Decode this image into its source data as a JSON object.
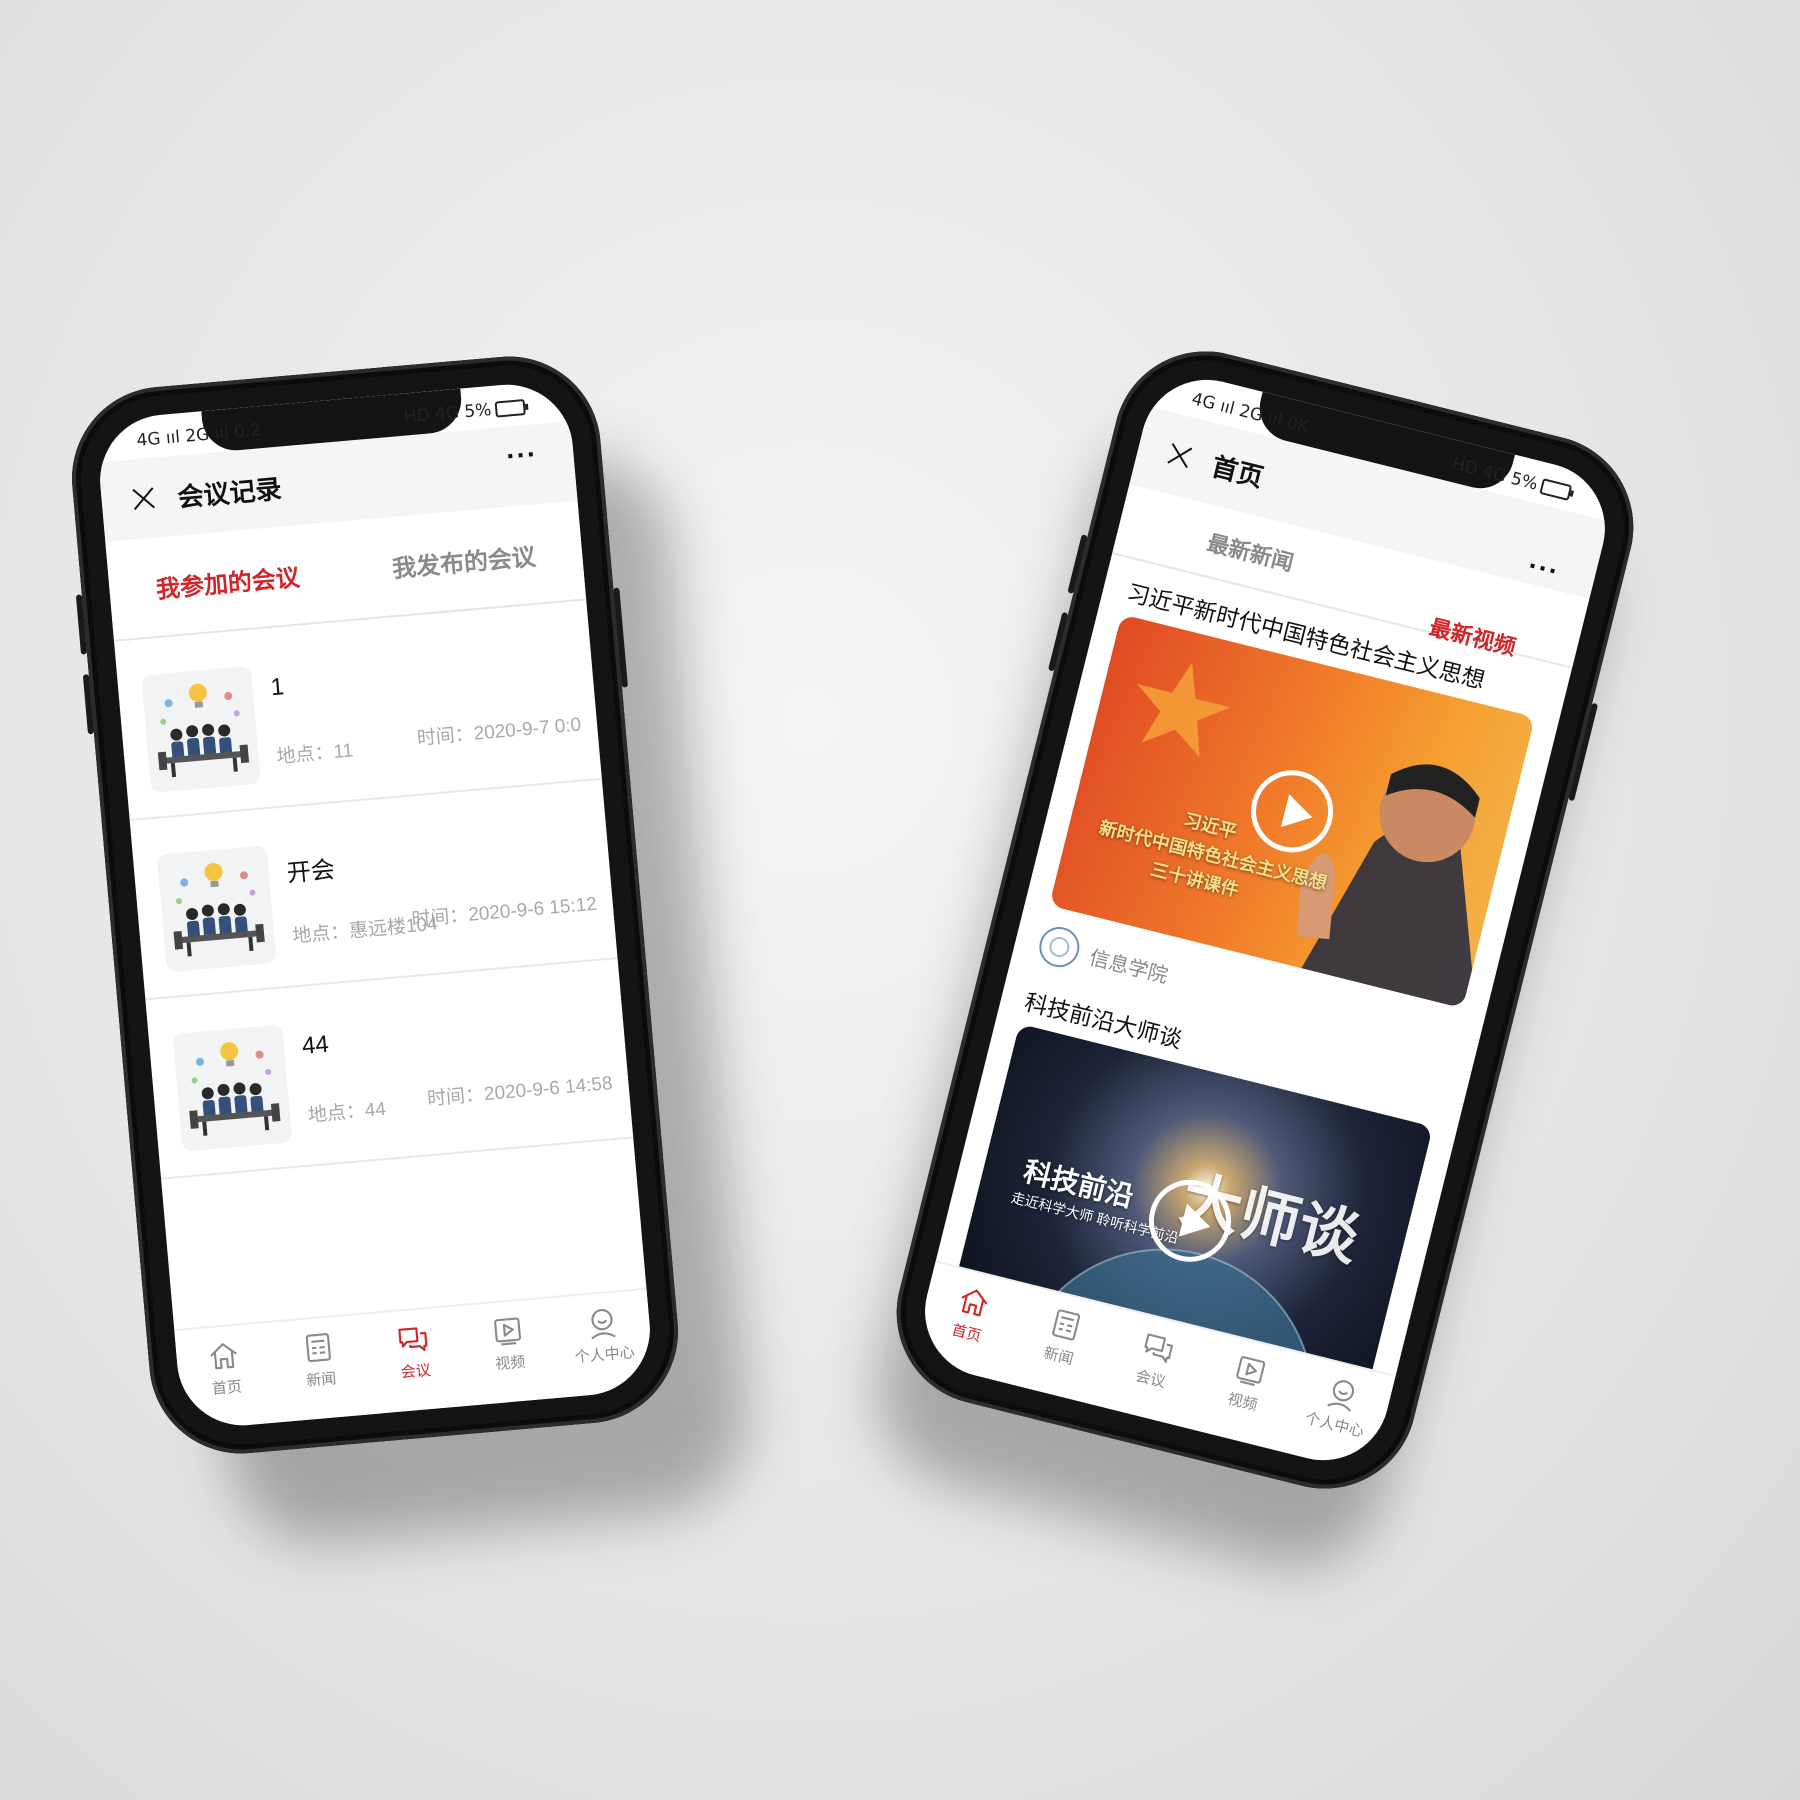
{
  "left_phone": {
    "status_left": "4G ııl 2G ııl 0.2",
    "status_right": "HD 4G 5%",
    "nav": {
      "title": "会议记录",
      "more": "···"
    },
    "tabs": [
      {
        "label": "我参加的会议",
        "active": true
      },
      {
        "label": "我发布的会议",
        "active": false
      }
    ],
    "meetings": [
      {
        "title": "1",
        "location": "地点：11",
        "time": "时间：2020-9-7 0:0"
      },
      {
        "title": "开会",
        "location": "地点：惠远楼104",
        "time": "时间：2020-9-6 15:12"
      },
      {
        "title": "44",
        "location": "地点：44",
        "time": "时间：2020-9-6 14:58"
      }
    ],
    "tabbar": [
      {
        "label": "首页",
        "icon": "home-icon",
        "active": false
      },
      {
        "label": "新闻",
        "icon": "news-icon",
        "active": false
      },
      {
        "label": "会议",
        "icon": "meeting-icon",
        "active": true
      },
      {
        "label": "视频",
        "icon": "video-icon",
        "active": false
      },
      {
        "label": "个人中心",
        "icon": "user-icon",
        "active": false
      }
    ]
  },
  "right_phone": {
    "status_left": "4G ııl 2G ııl 0K",
    "status_right": "HD 4G 5%",
    "nav": {
      "title": "首页",
      "more": "···"
    },
    "feed_tabs": [
      {
        "label": "最新新闻",
        "active": false
      },
      {
        "label": "最新视频",
        "active": true
      }
    ],
    "videos": [
      {
        "title": "习近平新时代中国特色社会主义思想",
        "overlay_lines": [
          "习近平",
          "新时代中国特色社会主义思想",
          "三十讲课件"
        ],
        "author": "信息学院"
      },
      {
        "title": "科技前沿大师谈",
        "overlay_lines": [
          "科技前沿",
          "走近科学大师 聆听科学前沿",
          "大师谈"
        ]
      }
    ],
    "tabbar": [
      {
        "label": "首页",
        "icon": "home-icon",
        "active": true
      },
      {
        "label": "新闻",
        "icon": "news-icon",
        "active": false
      },
      {
        "label": "会议",
        "icon": "meeting-icon",
        "active": false
      },
      {
        "label": "视频",
        "icon": "video-icon",
        "active": false
      },
      {
        "label": "个人中心",
        "icon": "user-icon",
        "active": false
      }
    ]
  },
  "colors": {
    "accent": "#d0262a",
    "muted": "#8a8a8a",
    "phone_body": "#141414"
  }
}
